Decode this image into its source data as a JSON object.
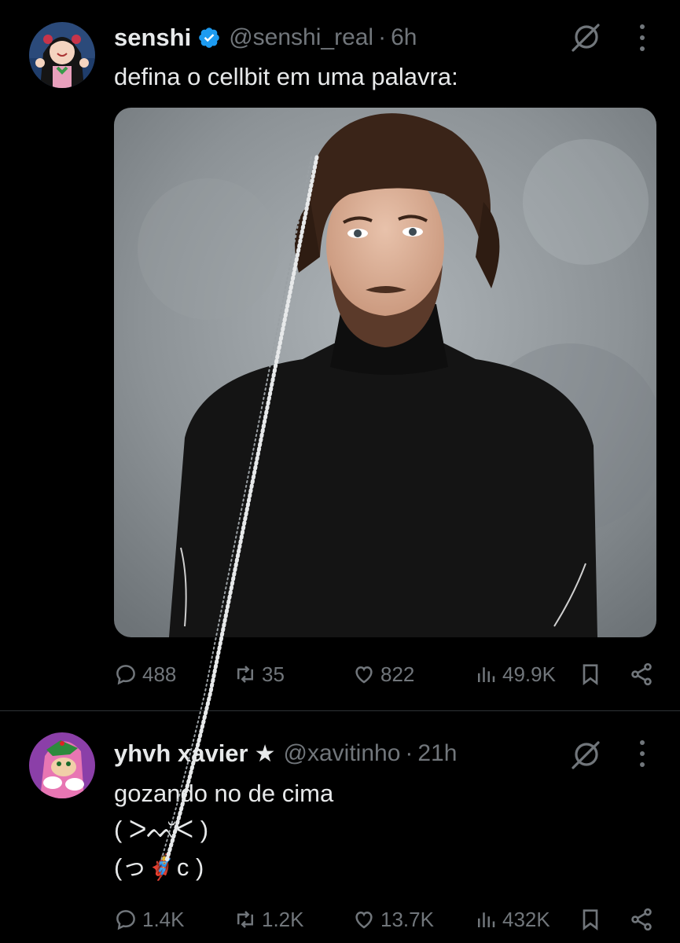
{
  "tweets": [
    {
      "display_name": "senshi",
      "handle": "@senshi_real",
      "separator": "·",
      "time": "6h",
      "lines": [
        "defina o cellbit em uma palavra:"
      ],
      "stats": {
        "replies": "488",
        "retweets": "35",
        "likes": "822",
        "views": "49.9K"
      },
      "verified": true
    },
    {
      "display_name": "yhvh xavier",
      "star": "★",
      "handle": "@xavitinho",
      "separator": "·",
      "time": "21h",
      "lines": [
        "gozando no de cima",
        "( ᐳᨓ̆ᐸ )",
        "(っ🦸ᴄ )"
      ],
      "stats": {
        "replies": "1.4K",
        "retweets": "1.2K",
        "likes": "13.7K",
        "views": "432K"
      },
      "verified": false
    }
  ],
  "colors": {
    "background": "#000000",
    "text": "#e7e9ea",
    "muted": "#71767b",
    "verified": "#1d9bf0",
    "divider": "#2f3336"
  },
  "icons": [
    "verified-badge-icon",
    "grok-icon",
    "more-icon",
    "reply-icon",
    "retweet-icon",
    "like-icon",
    "views-icon",
    "bookmark-icon",
    "share-icon"
  ]
}
